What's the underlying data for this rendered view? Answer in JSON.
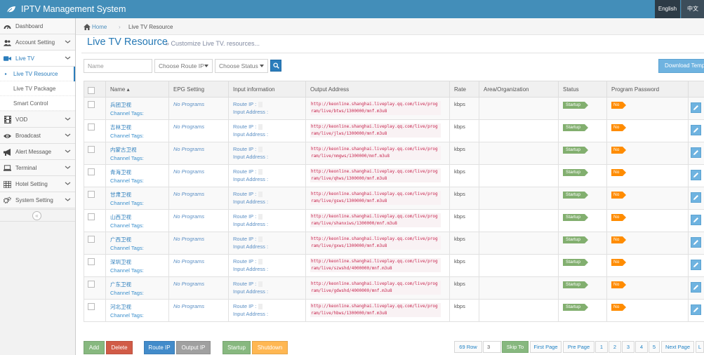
{
  "app": {
    "title": "IPTV Management System",
    "lang_en": "English",
    "lang_zh": "中文"
  },
  "sidebar": {
    "items": [
      {
        "label": "Dashboard",
        "icon": "tachometer-icon"
      },
      {
        "label": "Account Setting",
        "icon": "users-icon"
      },
      {
        "label": "Live TV",
        "icon": "video-camera-icon"
      },
      {
        "label": "VOD",
        "icon": "film-icon"
      },
      {
        "label": "Broadcast",
        "icon": "eye-icon"
      },
      {
        "label": "Alert Message",
        "icon": "bullhorn-icon"
      },
      {
        "label": "Terminal",
        "icon": "laptop-icon"
      },
      {
        "label": "Hotel Setting",
        "icon": "building-icon"
      },
      {
        "label": "System Setting",
        "icon": "cogs-icon"
      }
    ],
    "submenu": [
      {
        "label": "Live TV Resource"
      },
      {
        "label": "Live TV Package"
      },
      {
        "label": "Smart Control"
      }
    ],
    "collapse": "«"
  },
  "breadcrumb": {
    "home": "Home",
    "current": "Live TV Resource"
  },
  "page": {
    "title": "Live TV Resource",
    "subtitle": "» Customize Live TV. resources..."
  },
  "filters": {
    "name_placeholder": "Name",
    "route_ip": "Choose Route IP",
    "status": "Choose Status",
    "download": "Download Template"
  },
  "table": {
    "headers": [
      "Name ▴",
      "EPG Setting",
      "Input information",
      "Output Address",
      "Rate",
      "Area/Organization",
      "Status",
      "Program Password"
    ],
    "tags_label": "Channel Tags:",
    "route_label": "Route IP :",
    "addr_label": "Input Address :",
    "rows": [
      {
        "name": "兵团卫视",
        "epg": "No Programs",
        "url": "http://keonline.shanghai.liveplay.qq.com/live/program/live/btws/1300000/mnf.m3u8",
        "rate": "kbps",
        "status": "Startup",
        "pwd": "No"
      },
      {
        "name": "吉林卫视",
        "epg": "No Programs",
        "url": "http://keonline.shanghai.liveplay.qq.com/live/program/live/jlws/1300000/mnf.m3u8",
        "rate": "kbps",
        "status": "Startup",
        "pwd": "No"
      },
      {
        "name": "内蒙古卫视",
        "epg": "No Programs",
        "url": "http://keonline.shanghai.liveplay.qq.com/live/program/live/nmgws/1300000/mnf.m3u8",
        "rate": "kbps",
        "status": "Startup",
        "pwd": "No"
      },
      {
        "name": "青海卫视",
        "epg": "No Programs",
        "url": "http://keonline.shanghai.liveplay.qq.com/live/program/live/qhws/1300000/mnf.m3u8",
        "rate": "kbps",
        "status": "Startup",
        "pwd": "No"
      },
      {
        "name": "甘肃卫视",
        "epg": "No Programs",
        "url": "http://keonline.shanghai.liveplay.qq.com/live/program/live/gsws/1300000/mnf.m3u8",
        "rate": "kbps",
        "status": "Startup",
        "pwd": "No"
      },
      {
        "name": "山西卫视",
        "epg": "No Programs",
        "url": "http://keonline.shanghai.liveplay.qq.com/live/program/live/shanxiws/1300000/mnf.m3u8",
        "rate": "kbps",
        "status": "Startup",
        "pwd": "No"
      },
      {
        "name": "广西卫视",
        "epg": "No Programs",
        "url": "http://keonline.shanghai.liveplay.qq.com/live/program/live/gxws/1300000/mnf.m3u8",
        "rate": "kbps",
        "status": "Startup",
        "pwd": "No"
      },
      {
        "name": "深圳卫视",
        "epg": "No Programs",
        "url": "http://keonline.shanghai.liveplay.qq.com/live/program/live/szwshd/4000000/mnf.m3u8",
        "rate": "kbps",
        "status": "Startup",
        "pwd": "No"
      },
      {
        "name": "广东卫视",
        "epg": "No Programs",
        "url": "http://keonline.shanghai.liveplay.qq.com/live/program/live/gdwshd/4000000/mnf.m3u8",
        "rate": "kbps",
        "status": "Startup",
        "pwd": "No"
      },
      {
        "name": "河北卫视",
        "epg": "No Programs",
        "url": "http://keonline.shanghai.liveplay.qq.com/live/program/live/hbws/1300000/mnf.m3u8",
        "rate": "kbps",
        "status": "Startup",
        "pwd": "No"
      }
    ]
  },
  "actions": {
    "add": "Add",
    "delete": "Delete",
    "route_ip": "Route IP",
    "output_ip": "Output IP",
    "startup": "Startup",
    "shutdown": "Shutdown"
  },
  "pagination": {
    "rows": "69 Row",
    "page_input": "3",
    "skip": "Skip To",
    "first": "First Page",
    "prev": "Pre Page",
    "pages": [
      "1",
      "2",
      "3",
      "4",
      "5"
    ],
    "next": "Next Page",
    "last": "L"
  },
  "colors": {
    "header": "#438eb9",
    "primary": "#2b7dbc",
    "success": "#82af6f",
    "danger": "#d15b47",
    "warning": "#ffb752",
    "grey": "#a0a0a0"
  }
}
